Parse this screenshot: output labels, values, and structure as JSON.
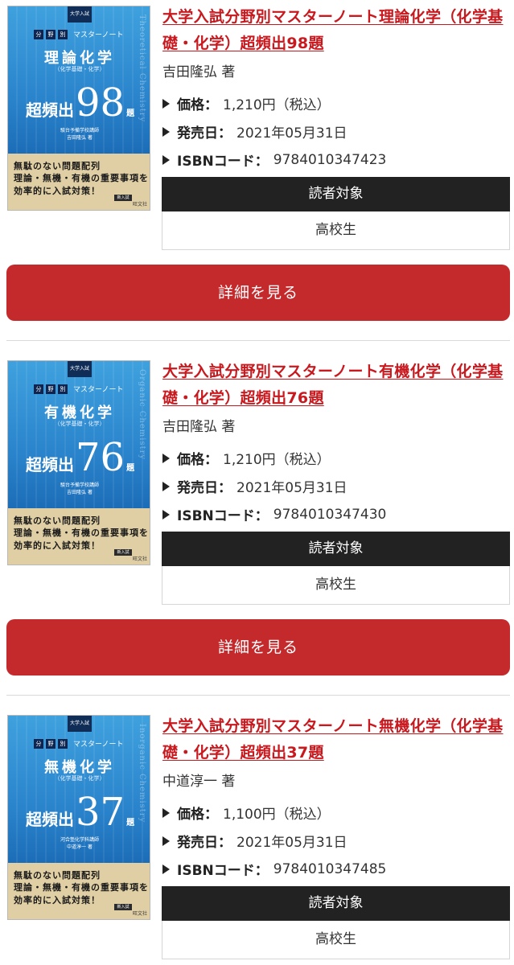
{
  "items": [
    {
      "title": "大学入試分野別マスターノート理論化学（化学基礎・化学）超頻出98題",
      "author": "吉田隆弘 著",
      "price_label": "価格：",
      "price": "1,210円（税込）",
      "date_label": "発売日：",
      "date": "2021年05月31日",
      "isbn_label": "ISBNコード：",
      "isbn": "9784010347423",
      "reader_header": "読者対象",
      "reader_value": "高校生",
      "detail_button": "詳細を見る",
      "cover": {
        "badge": "大学入試",
        "series": [
          "分",
          "野",
          "別"
        ],
        "series_text": "マスターノート",
        "subject": "理論化学",
        "paren": "（化学基礎・化学）",
        "freq": "超頻出",
        "number": "98",
        "dai": "題",
        "author_line1": "駿台予備学校講師",
        "author_line2": "吉田隆弘 著",
        "vertical": "Theoretical Chemistry",
        "catch": [
          "無駄のない問題配列",
          "理論・無機・有機の重要事項を",
          "効率的に入試対策！"
        ],
        "logo": "新入試",
        "publisher": "旺文社"
      }
    },
    {
      "title": "大学入試分野別マスターノート有機化学（化学基礎・化学）超頻出76題",
      "author": "吉田隆弘 著",
      "price_label": "価格：",
      "price": "1,210円（税込）",
      "date_label": "発売日：",
      "date": "2021年05月31日",
      "isbn_label": "ISBNコード：",
      "isbn": "9784010347430",
      "reader_header": "読者対象",
      "reader_value": "高校生",
      "detail_button": "詳細を見る",
      "cover": {
        "badge": "大学入試",
        "series": [
          "分",
          "野",
          "別"
        ],
        "series_text": "マスターノート",
        "subject": "有機化学",
        "paren": "（化学基礎・化学）",
        "freq": "超頻出",
        "number": "76",
        "dai": "題",
        "author_line1": "駿台予備学校講師",
        "author_line2": "吉田隆弘 著",
        "vertical": "Organic Chemistry",
        "catch": [
          "無駄のない問題配列",
          "理論・無機・有機の重要事項を",
          "効率的に入試対策！"
        ],
        "logo": "新入試",
        "publisher": "旺文社"
      }
    },
    {
      "title": "大学入試分野別マスターノート無機化学（化学基礎・化学）超頻出37題",
      "author": "中道淳一 著",
      "price_label": "価格：",
      "price": "1,100円（税込）",
      "date_label": "発売日：",
      "date": "2021年05月31日",
      "isbn_label": "ISBNコード：",
      "isbn": "9784010347485",
      "reader_header": "読者対象",
      "reader_value": "高校生",
      "detail_button": "詳細を見る",
      "cover": {
        "badge": "大学入試",
        "series": [
          "分",
          "野",
          "別"
        ],
        "series_text": "マスターノート",
        "subject": "無機化学",
        "paren": "（化学基礎・化学）",
        "freq": "超頻出",
        "number": "37",
        "dai": "題",
        "author_line1": "河合塾化学科講師",
        "author_line2": "中道淳一 著",
        "vertical": "Inorganic Chemistry",
        "catch": [
          "無駄のない問題配列",
          "理論・無機・有機の重要事項を",
          "効率的に入試対策！"
        ],
        "logo": "新入試",
        "publisher": "旺文社"
      }
    }
  ]
}
